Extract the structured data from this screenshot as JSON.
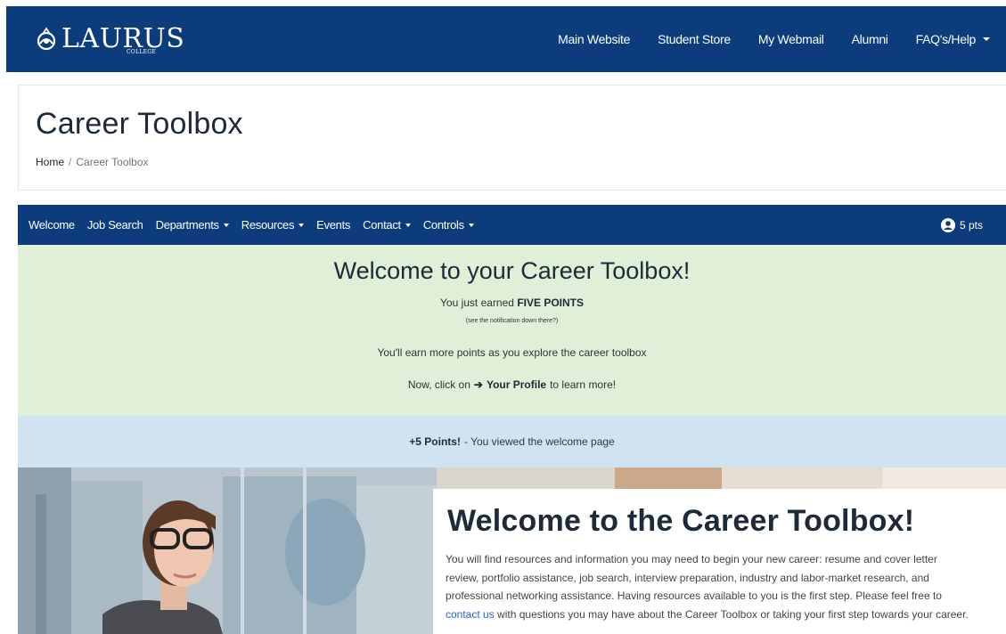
{
  "brand": {
    "name": "LAURUS",
    "subtitle": "COLLEGE"
  },
  "topnav": {
    "items": [
      {
        "label": "Main Website"
      },
      {
        "label": "Student Store"
      },
      {
        "label": "My Webmail"
      },
      {
        "label": "Alumni"
      },
      {
        "label": "FAQ's/Help"
      }
    ]
  },
  "page": {
    "title": "Career Toolbox",
    "breadcrumb": {
      "home": "Home",
      "separator": "/",
      "current": "Career Toolbox"
    }
  },
  "subnav": {
    "items": [
      {
        "label": "Welcome"
      },
      {
        "label": "Job Search"
      },
      {
        "label": "Departments"
      },
      {
        "label": "Resources"
      },
      {
        "label": "Events"
      },
      {
        "label": "Contact"
      },
      {
        "label": "Controls"
      }
    ],
    "points": "5 pts",
    "user_icon": "user-circle-icon"
  },
  "welcome": {
    "heading": "Welcome to your Career Toolbox!",
    "earned_prefix": "You just earned",
    "earned_bold": "FIVE POINTS",
    "note": "(see the notification down there?)",
    "explore": "You'll earn more points as you explore the career toolbox",
    "profile_prefix": "Now, click on",
    "profile_arrow": "➔",
    "profile_link": "Your Profile",
    "profile_suffix": "to learn more!"
  },
  "notification": {
    "bold": "+5 Points!",
    "text": "- You viewed the welcome page"
  },
  "hero": {
    "title": "Welcome to the Career Toolbox!",
    "text_before": "You will find resources and information you may need to begin your new career: resume and cover letter review, portfolio assistance, job search, interview preparation, industry and labor-market research, and professional networking assistance. Having resources available to you is the first step. Please feel free to",
    "link": "contact us",
    "text_after": "with questions you may have about the Career Toolbox or taking your first step towards your career."
  },
  "colors": {
    "navy": "#0c3c7c",
    "success_bg": "#dfefd8",
    "info_bg": "#cfe3f3",
    "link": "#2563c9"
  }
}
